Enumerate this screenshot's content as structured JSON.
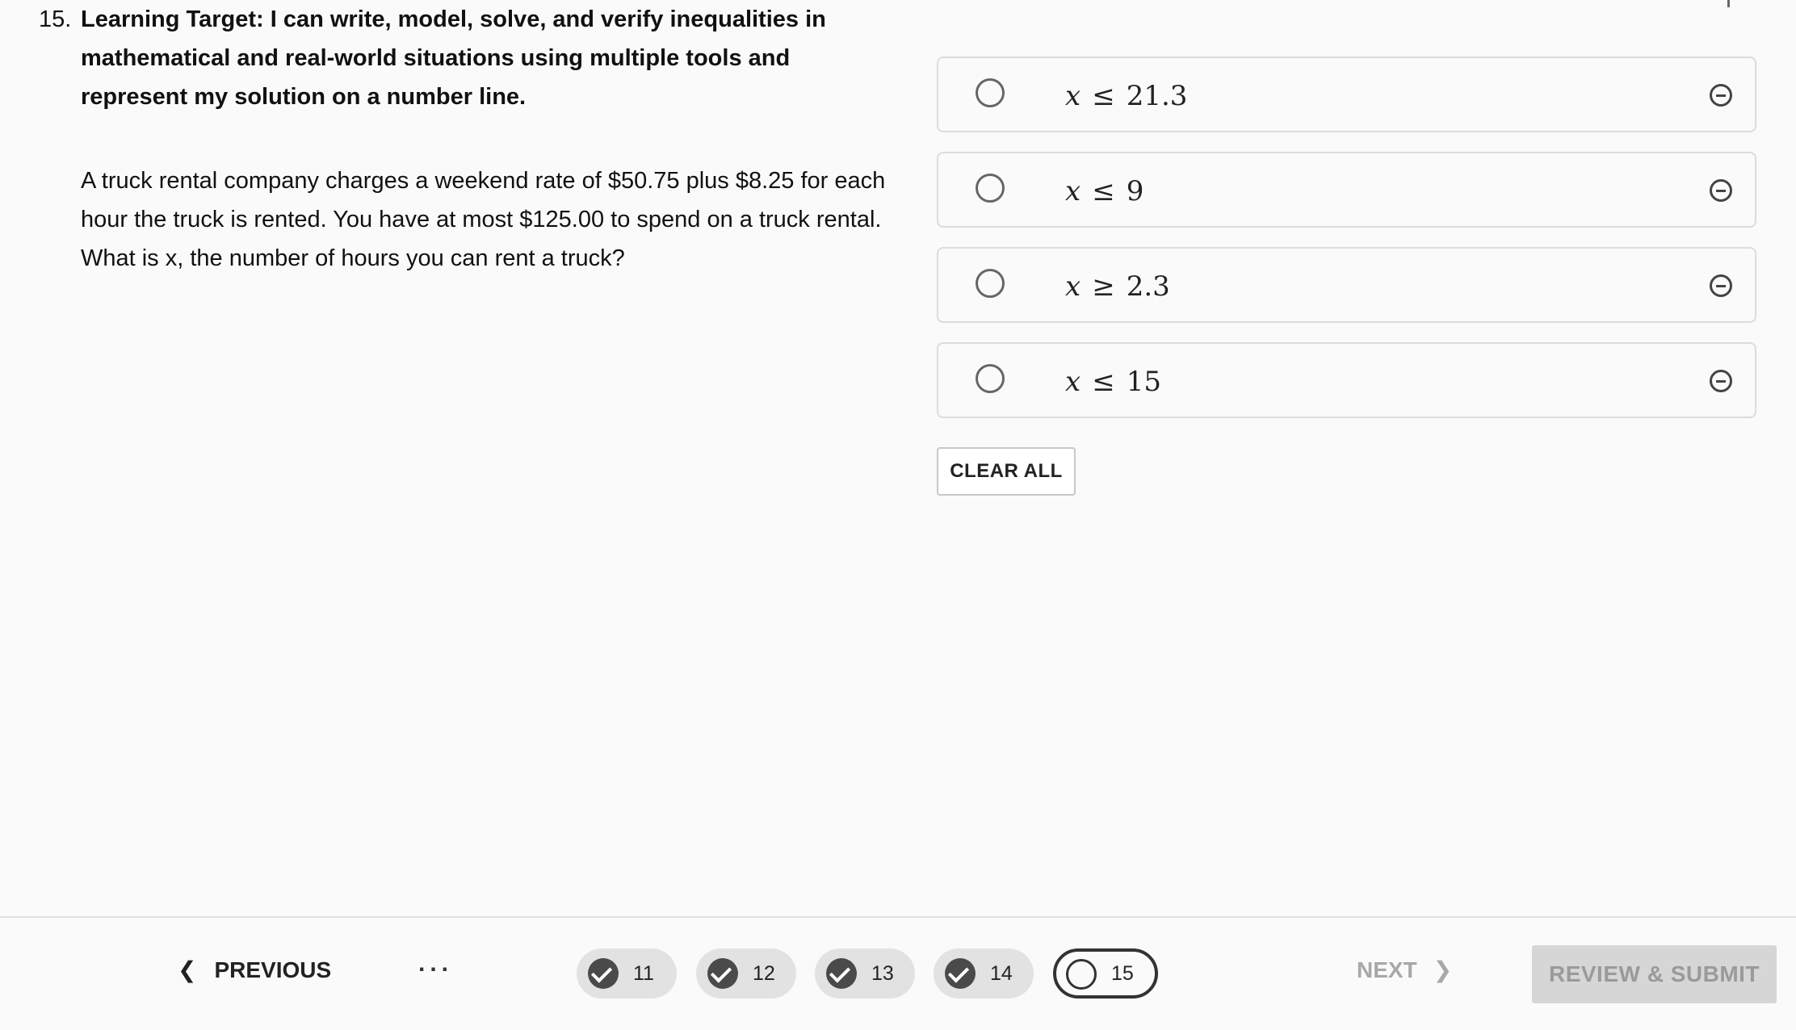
{
  "question": {
    "number": "15.",
    "target": "Learning Target: I can write, model, solve, and verify inequalities in mathematical and real-world situations using multiple tools and represent my solution on a number line.",
    "body": "A truck rental company charges a weekend rate of $50.75 plus $8.25 for each hour the truck is rented.  You have at most $125.00 to spend on a truck rental.  What is x, the number of hours you can rent a truck?"
  },
  "choices": [
    {
      "var": "x",
      "op": "≤",
      "value": "21.3",
      "eliminate_icon": "minus-circle-icon"
    },
    {
      "var": "x",
      "op": "≤",
      "value": "9",
      "eliminate_icon": "minus-circle-icon"
    },
    {
      "var": "x",
      "op": "≥",
      "value": "2.3",
      "eliminate_icon": "minus-circle-icon"
    },
    {
      "var": "x",
      "op": "≤",
      "value": "15",
      "eliminate_icon": "minus-circle-icon"
    }
  ],
  "clear_all_label": "CLEAR ALL",
  "footer": {
    "previous_label": "PREVIOUS",
    "ellipsis": "...",
    "pages": [
      {
        "number": "11",
        "status": "answered"
      },
      {
        "number": "12",
        "status": "answered"
      },
      {
        "number": "13",
        "status": "answered"
      },
      {
        "number": "14",
        "status": "answered"
      },
      {
        "number": "15",
        "status": "current"
      }
    ],
    "next_label": "NEXT",
    "submit_label": "REVIEW & SUBMIT"
  },
  "colors": {
    "background": "#fafafa",
    "answered_pill": "#e2e2e2",
    "check_icon": "#4a4a4a",
    "disabled_text": "#a8a8a8",
    "submit_bg": "#d6d6d6"
  }
}
